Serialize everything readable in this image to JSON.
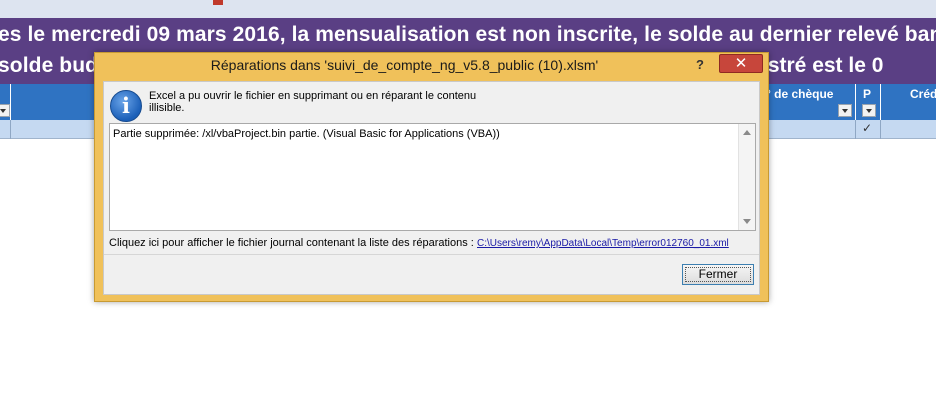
{
  "sheet": {
    "banner_line1": "es le mercredi 09 mars 2016, la mensualisation est non inscrite, le solde au dernier relevé banc",
    "banner_line2_left": "solde bud",
    "banner_line2_right": "istré est le 0",
    "col_cheque": "° de chèque",
    "col_p": "P",
    "col_cred": "Créd",
    "check_mark": "✓"
  },
  "dialog": {
    "title": "Réparations dans 'suivi_de_compte_ng_v5.8_public (10).xlsm'",
    "help": "?",
    "close": "✕",
    "message_line1": "Excel a pu ouvrir le fichier en supprimant ou en réparant le contenu",
    "message_line2": "illisible.",
    "details": "Partie supprimée: /xl/vbaProject.bin partie.  (Visual Basic for Applications (VBA))",
    "log_label": "Cliquez ici pour afficher le fichier journal contenant la liste des réparations :",
    "log_link": "C:\\Users\\remy\\AppData\\Local\\Temp\\error012760_01.xml",
    "close_button": "Fermer",
    "icon": "info-icon"
  },
  "colors": {
    "banner": "#5a3f84",
    "header": "#2f73c2",
    "dialog_frame": "#f0c15a",
    "close_red": "#c7463b"
  }
}
